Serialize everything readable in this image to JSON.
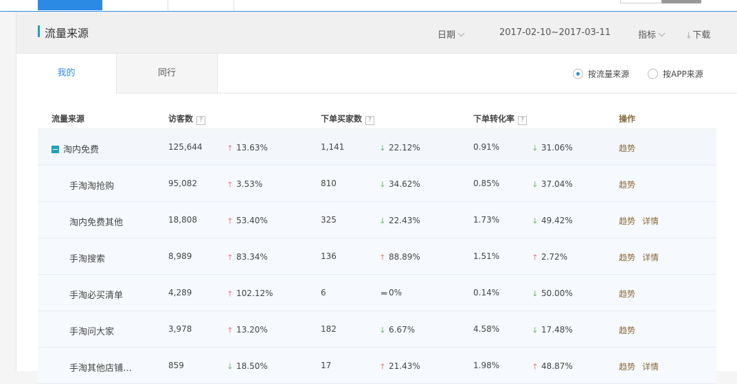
{
  "colors": {
    "accent": "#2b8be4",
    "up": "#e34b4b",
    "down": "#2f9a3b",
    "action": "#876a3a",
    "title_bar": "#1ba1b9"
  },
  "panel": {
    "title": "流量来源",
    "date_label": "日期",
    "date_range": "2017-02-10~2017-03-11",
    "metric_label": "指标",
    "download_label": "下载"
  },
  "tabs": {
    "mine": "我的",
    "peer": "同行"
  },
  "radios": {
    "by_traffic": "按流量来源",
    "by_app": "按APP来源"
  },
  "table": {
    "headers": {
      "source": "流量来源",
      "visitors": "访客数",
      "buyers": "下单买家数",
      "conversion": "下单转化率",
      "ops": "操作"
    },
    "help_glyph": "?",
    "rows": [
      {
        "name": "淘内免费",
        "visitors": "125,644",
        "v_change": "13.63%",
        "v_dir": "up",
        "buyers": "1,141",
        "b_change": "22.12%",
        "b_dir": "down",
        "rate": "0.91%",
        "r_change": "31.06%",
        "r_dir": "down",
        "trend": "趋势",
        "detail": ""
      },
      {
        "name": "手淘淘抢购",
        "visitors": "95,082",
        "v_change": "3.53%",
        "v_dir": "up",
        "buyers": "810",
        "b_change": "34.62%",
        "b_dir": "down",
        "rate": "0.85%",
        "r_change": "37.04%",
        "r_dir": "down",
        "trend": "趋势",
        "detail": ""
      },
      {
        "name": "淘内免费其他",
        "visitors": "18,808",
        "v_change": "53.40%",
        "v_dir": "up",
        "buyers": "325",
        "b_change": "22.43%",
        "b_dir": "down",
        "rate": "1.73%",
        "r_change": "49.42%",
        "r_dir": "down",
        "trend": "趋势",
        "detail": "详情"
      },
      {
        "name": "手淘搜索",
        "visitors": "8,989",
        "v_change": "83.34%",
        "v_dir": "up",
        "buyers": "136",
        "b_change": "88.89%",
        "b_dir": "up",
        "rate": "1.51%",
        "r_change": "2.72%",
        "r_dir": "up",
        "trend": "趋势",
        "detail": "详情"
      },
      {
        "name": "手淘必买清单",
        "visitors": "4,289",
        "v_change": "102.12%",
        "v_dir": "up",
        "buyers": "6",
        "b_change": "0%",
        "b_dir": "flat",
        "rate": "0.14%",
        "r_change": "50.00%",
        "r_dir": "down",
        "trend": "趋势",
        "detail": ""
      },
      {
        "name": "手淘问大家",
        "visitors": "3,978",
        "v_change": "13.20%",
        "v_dir": "up",
        "buyers": "182",
        "b_change": "6.67%",
        "b_dir": "down",
        "rate": "4.58%",
        "r_change": "17.48%",
        "r_dir": "down",
        "trend": "趋势",
        "detail": ""
      },
      {
        "name": "手淘其他店铺…",
        "visitors": "859",
        "v_change": "18.50%",
        "v_dir": "down",
        "buyers": "17",
        "b_change": "21.43%",
        "b_dir": "up",
        "rate": "1.98%",
        "r_change": "48.87%",
        "r_dir": "up",
        "trend": "趋势",
        "detail": "详情"
      }
    ]
  }
}
